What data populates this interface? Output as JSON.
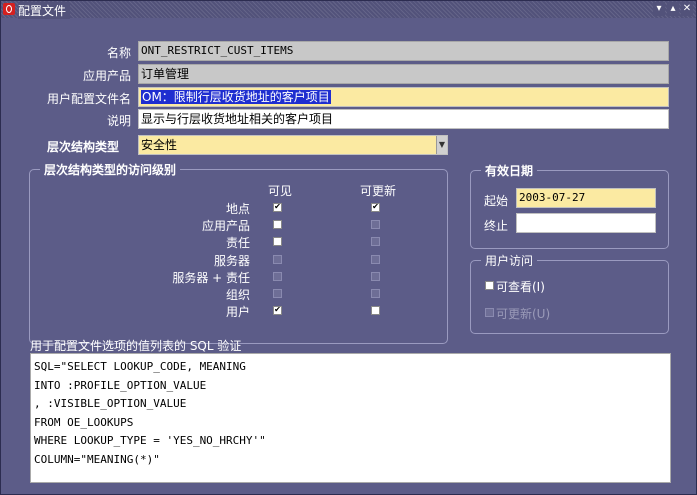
{
  "window": {
    "title": "配置文件"
  },
  "form": {
    "name_label": "名称",
    "name_value": "ONT_RESTRICT_CUST_ITEMS",
    "app_label": "应用产品",
    "app_value": "订单管理",
    "user_profile_label": "用户配置文件名",
    "user_profile_value": "OM：限制行层收货地址的客户项目",
    "desc_label": "说明",
    "desc_value": "显示与行层收货地址相关的客户项目",
    "hier_label": "层次结构类型",
    "hier_value": "安全性"
  },
  "access_level": {
    "title": "层次结构类型的访问级别",
    "col_visible": "可见",
    "col_updatable": "可更新",
    "rows": [
      {
        "label": "地点",
        "visible": true,
        "updatable": true
      },
      {
        "label": "应用产品",
        "visible": false,
        "updatable": false
      },
      {
        "label": "责任",
        "visible": false,
        "updatable": false
      },
      {
        "label": "服务器",
        "visible": false,
        "updatable": false
      },
      {
        "label": "服务器 + 责任",
        "visible": false,
        "updatable": false
      },
      {
        "label": "组织",
        "visible": false,
        "updatable": false
      },
      {
        "label": "用户",
        "visible": true,
        "updatable": false
      }
    ]
  },
  "effective": {
    "title": "有效日期",
    "start_label": "起始",
    "start_value": "2003-07-27",
    "end_label": "终止",
    "end_value": ""
  },
  "user_access": {
    "title": "用户访问",
    "view_label": "可查看(I)",
    "update_label": "可更新(U)"
  },
  "sql": {
    "label": "用于配置文件选项的值列表的 SQL 验证",
    "lines": [
      "SQL=\"SELECT LOOKUP_CODE, MEANING",
      "INTO :PROFILE_OPTION_VALUE",
      ", :VISIBLE_OPTION_VALUE",
      "FROM OE_LOOKUPS",
      "WHERE LOOKUP_TYPE = 'YES_NO_HRCHY'\"",
      "COLUMN=\"MEANING(*)\""
    ]
  },
  "colors": {
    "window_bg": "#5c5c88",
    "field_yellow": "#fbeaa2",
    "field_gray": "#c8c8c8",
    "selection": "#1f2ed0"
  }
}
